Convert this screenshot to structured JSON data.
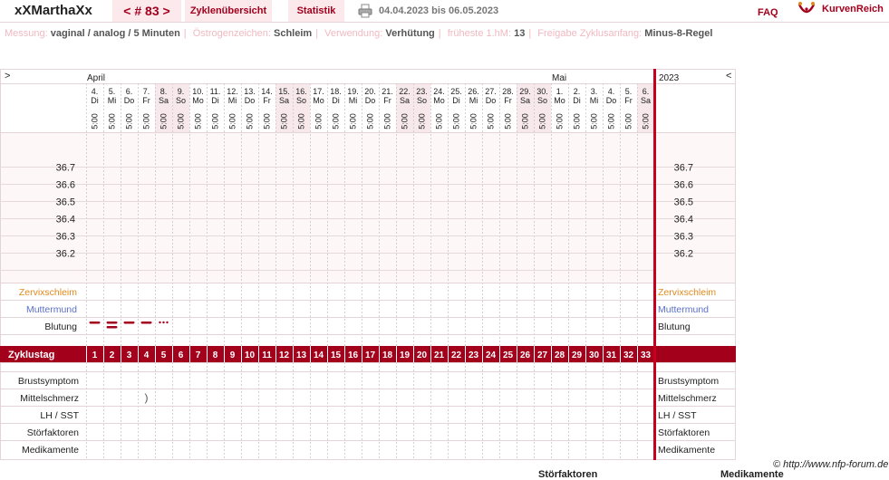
{
  "header": {
    "user": "xXMarthaXx",
    "cycle_nav": "< # 83 >",
    "tab_overview": "Zyklenübersicht",
    "tab_stats": "Statistik",
    "date_range": "04.04.2023 bis 06.05.2023",
    "faq": "FAQ",
    "logo_text": "KurvenReich",
    "accent": "#a3001c"
  },
  "info": {
    "messung_label": "Messung:",
    "messung_value": "vaginal / analog / 5 Minuten",
    "oestrogen_label": "Östrogenzeichen:",
    "oestrogen_value": "Schleim",
    "verwendung_label": "Verwendung:",
    "verwendung_value": "Verhütung",
    "fruehest_label": "früheste 1.hM:",
    "fruehest_value": "13",
    "freigabe_label": "Freigabe Zyklusanfang:",
    "freigabe_value": "Minus-8-Regel"
  },
  "chart": {
    "nav_left": ">",
    "nav_right": "<",
    "month_start": "April",
    "month_second": "Mai",
    "year": "2023",
    "time": "5:00",
    "days": [
      {
        "d": "4.",
        "w": "Di"
      },
      {
        "d": "5.",
        "w": "Mi"
      },
      {
        "d": "6.",
        "w": "Do"
      },
      {
        "d": "7.",
        "w": "Fr"
      },
      {
        "d": "8.",
        "w": "Sa"
      },
      {
        "d": "9.",
        "w": "So"
      },
      {
        "d": "10.",
        "w": "Mo"
      },
      {
        "d": "11.",
        "w": "Di"
      },
      {
        "d": "12.",
        "w": "Mi"
      },
      {
        "d": "13.",
        "w": "Do"
      },
      {
        "d": "14.",
        "w": "Fr"
      },
      {
        "d": "15.",
        "w": "Sa"
      },
      {
        "d": "16.",
        "w": "So"
      },
      {
        "d": "17.",
        "w": "Mo"
      },
      {
        "d": "18.",
        "w": "Di"
      },
      {
        "d": "19.",
        "w": "Mi"
      },
      {
        "d": "20.",
        "w": "Do"
      },
      {
        "d": "21.",
        "w": "Fr"
      },
      {
        "d": "22.",
        "w": "Sa"
      },
      {
        "d": "23.",
        "w": "So"
      },
      {
        "d": "24.",
        "w": "Mo"
      },
      {
        "d": "25.",
        "w": "Di"
      },
      {
        "d": "26.",
        "w": "Mi"
      },
      {
        "d": "27.",
        "w": "Do"
      },
      {
        "d": "28.",
        "w": "Fr"
      },
      {
        "d": "29.",
        "w": "Sa"
      },
      {
        "d": "30.",
        "w": "So"
      },
      {
        "d": "1.",
        "w": "Mo"
      },
      {
        "d": "2.",
        "w": "Di"
      },
      {
        "d": "3.",
        "w": "Mi"
      },
      {
        "d": "4.",
        "w": "Do"
      },
      {
        "d": "5.",
        "w": "Fr"
      },
      {
        "d": "6.",
        "w": "Sa"
      }
    ],
    "temps": [
      "36.7",
      "36.6",
      "36.5",
      "36.4",
      "36.3",
      "36.2"
    ],
    "rows_top": [
      "Zervixschleim",
      "Muttermund",
      "Blutung"
    ],
    "row_colors": [
      "#e08a1e",
      "#5a6fc8",
      "#222222"
    ],
    "cycle_label": "Zyklustag",
    "rows_bottom": [
      "Brustsymptom",
      "Mittelschmerz",
      "LH / SST",
      "Störfaktoren",
      "Medikamente"
    ],
    "bleeding": [
      {
        "day": 1,
        "type": "heavy"
      },
      {
        "day": 2,
        "type": "double"
      },
      {
        "day": 3,
        "type": "heavy"
      },
      {
        "day": 4,
        "type": "heavy"
      },
      {
        "day": 5,
        "type": "spotting"
      }
    ],
    "mittelschmerz_day": 4,
    "mittelschmerz_symbol": ")"
  },
  "footer": {
    "copyright": "© http://www.nfp-forum.de",
    "cut_label_1": "Störfaktoren",
    "cut_label_2": "Medikamente"
  }
}
